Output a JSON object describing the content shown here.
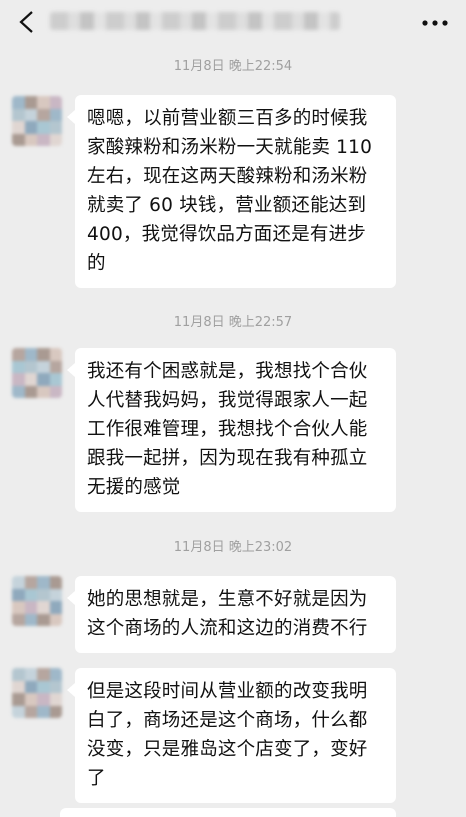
{
  "header": {
    "title": "",
    "back_icon": "chevron-left-icon",
    "more_icon": "more-dots-icon"
  },
  "messages": [
    {
      "timestamp": "11月8日 晚上22:54",
      "lines": [
        "嗯嗯，以前营业额三百多的时候我",
        "家酸辣粉和汤米粉一天就能卖 110",
        "左右，现在这两天酸辣粉和汤米粉",
        "就卖了 60 块钱，营业额还能达到",
        "400，我觉得饮品方面还是有进步",
        "的"
      ]
    },
    {
      "timestamp": "11月8日 晚上22:57",
      "lines": [
        "我还有个困惑就是，我想找个合伙",
        "人代替我妈妈，我觉得跟家人一起",
        "工作很难管理，我想找个合伙人能",
        "跟我一起拼，因为现在我有种孤立",
        "无援的感觉"
      ]
    },
    {
      "timestamp": "11月8日 晚上23:02",
      "lines": [
        "她的思想就是，生意不好就是因为",
        "这个商场的人流和这边的消费不行"
      ]
    },
    {
      "timestamp": "",
      "lines": [
        "但是这段时间从营业额的改变我明",
        "白了，商场还是这个商场，什么都",
        "没变，只是雅岛这个店变了，变好",
        "了"
      ]
    }
  ]
}
